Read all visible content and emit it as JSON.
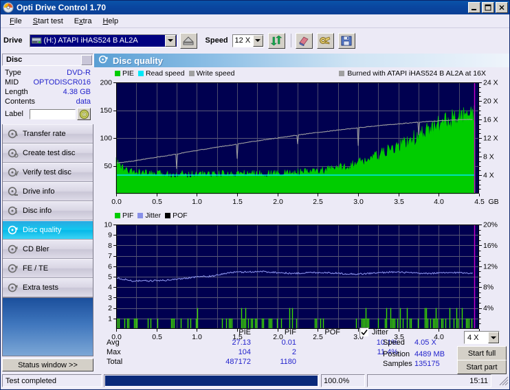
{
  "window": {
    "title": "Opti Drive Control 1.70",
    "icon": "disc-icon",
    "minimize": "minimize-icon",
    "maximize": "maximize-icon",
    "close": "close-icon"
  },
  "menubar": {
    "items": [
      {
        "label": "File",
        "accel": "F"
      },
      {
        "label": "Start test",
        "accel": "S"
      },
      {
        "label": "Extra",
        "accel": "x"
      },
      {
        "label": "Help",
        "accel": "H"
      }
    ]
  },
  "toolbar": {
    "drive_label": "Drive",
    "drive_value": "(H:)   ATAPI iHAS524   B AL2A",
    "eject_icon": "eject-icon",
    "speed_label": "Speed",
    "speed_value": "12 X",
    "refresh_icon": "refresh-icon",
    "erase_icon": "eraser-icon",
    "bitsetting_icon": "bitsetting-icon",
    "save_icon": "save-icon"
  },
  "disc_panel": {
    "header": "Disc",
    "rows": [
      {
        "key": "Type",
        "value": "DVD-R"
      },
      {
        "key": "MID",
        "value": "OPTODISCR016"
      },
      {
        "key": "Length",
        "value": "4.38 GB"
      },
      {
        "key": "Contents",
        "value": "data"
      }
    ],
    "label_key": "Label",
    "label_value": "",
    "label_button_icon": "disc-refresh-icon"
  },
  "nav": {
    "items": [
      {
        "label": "Transfer rate",
        "icon": "disc-rate-icon",
        "selected": false
      },
      {
        "label": "Create test disc",
        "icon": "disc-create-icon",
        "selected": false
      },
      {
        "label": "Verify test disc",
        "icon": "disc-verify-icon",
        "selected": false
      },
      {
        "label": "Drive info",
        "icon": "disc-drive-icon",
        "selected": false
      },
      {
        "label": "Disc info",
        "icon": "disc-info-icon",
        "selected": false
      },
      {
        "label": "Disc quality",
        "icon": "disc-quality-icon",
        "selected": true
      },
      {
        "label": "CD Bler",
        "icon": "disc-bler-icon",
        "selected": false
      },
      {
        "label": "FE / TE",
        "icon": "disc-fete-icon",
        "selected": false
      },
      {
        "label": "Extra tests",
        "icon": "disc-extra-icon",
        "selected": false
      }
    ],
    "status_window_button": "Status window >>"
  },
  "panel": {
    "title": "Disc quality",
    "title_icon": "disc-quality-icon"
  },
  "chart_data": [
    {
      "type": "area",
      "name": "pie-chart",
      "title": "",
      "xlabel": "GB",
      "ylabel": "",
      "xlim": [
        0.0,
        4.5
      ],
      "ylim": [
        0,
        200
      ],
      "y2lim": [
        0,
        24
      ],
      "xticks": [
        "0.0",
        "0.5",
        "1.0",
        "1.5",
        "2.0",
        "2.5",
        "3.0",
        "3.5",
        "4.0",
        "4.5"
      ],
      "x_unit": "GB",
      "yticks": [
        "200",
        "150",
        "100",
        "50"
      ],
      "y2ticks": [
        "24 X",
        "20 X",
        "16 X",
        "12 X",
        "8 X",
        "4 X"
      ],
      "grid": true,
      "legend_position": "top-left",
      "legend": [
        {
          "name": "PIE",
          "color": "#00cc00"
        },
        {
          "name": "Read speed",
          "color": "#00e8f8"
        },
        {
          "name": "Write speed",
          "color": "#a0a0a0"
        }
      ],
      "annotation": {
        "text": "Burned with ATAPI iHAS524   B AL2A at 16X",
        "swatch": "#a0a0a0"
      },
      "series": [
        {
          "name": "PIE",
          "color": "#00cc00",
          "kind": "bars",
          "note": "dense green bars, baseline fill to 0; average about 27, rising from ~30 early to ~120 at end of disc",
          "x": [
            0.0,
            0.1,
            0.2,
            0.3,
            0.4,
            0.5,
            0.6,
            0.7,
            0.8,
            0.9,
            1.0,
            1.1,
            1.2,
            1.3,
            1.4,
            1.5,
            1.6,
            1.7,
            1.8,
            1.9,
            2.0,
            2.1,
            2.2,
            2.3,
            2.4,
            2.5,
            2.6,
            2.7,
            2.8,
            2.9,
            3.0,
            3.1,
            3.2,
            3.3,
            3.4,
            3.5,
            3.6,
            3.7,
            3.8,
            3.9,
            4.0,
            4.1,
            4.2,
            4.3,
            4.4
          ],
          "values": [
            55,
            40,
            36,
            35,
            34,
            33,
            33,
            33,
            33,
            33,
            33,
            33,
            33,
            33,
            33,
            34,
            34,
            34,
            34,
            34,
            35,
            35,
            36,
            36,
            37,
            38,
            40,
            42,
            45,
            48,
            52,
            57,
            62,
            68,
            74,
            80,
            88,
            95,
            102,
            110,
            118,
            124,
            128,
            130,
            132
          ]
        },
        {
          "name": "Read speed",
          "color": "#00e8f8",
          "kind": "line",
          "note": "flat horizontal cyan line at 4X for the whole scan",
          "x": [
            0.0,
            4.45
          ],
          "values": [
            4,
            4
          ]
        },
        {
          "name": "Write speed",
          "color": "#a0a0a0",
          "kind": "line",
          "note": "gray CAV ramp from about 6.5X to 16X with regular downward spikes (link/OPC dips)",
          "x": [
            0.0,
            0.2,
            0.4,
            0.6,
            0.8,
            1.0,
            1.2,
            1.4,
            1.6,
            1.8,
            2.0,
            2.2,
            2.4,
            2.6,
            2.8,
            3.0,
            3.2,
            3.4,
            3.6,
            3.8,
            4.0,
            4.2,
            4.4
          ],
          "values": [
            6.6,
            7.0,
            7.6,
            8.1,
            8.7,
            9.3,
            9.9,
            10.4,
            11.0,
            11.5,
            12.0,
            12.5,
            13.0,
            13.4,
            13.8,
            14.2,
            14.6,
            14.9,
            15.2,
            15.5,
            15.7,
            15.9,
            16.0
          ]
        }
      ]
    },
    {
      "type": "area",
      "name": "pif-jitter-chart",
      "title": "",
      "xlabel": "GB",
      "ylabel": "",
      "xlim": [
        0.0,
        4.5
      ],
      "ylim": [
        0,
        10
      ],
      "y2lim": [
        0,
        20
      ],
      "xticks": [
        "0.0",
        "0.5",
        "1.0",
        "1.5",
        "2.0",
        "2.5",
        "3.0",
        "3.5",
        "4.0",
        "4.5"
      ],
      "x_unit": "GB",
      "yticks": [
        "10",
        "9",
        "8",
        "7",
        "6",
        "5",
        "4",
        "3",
        "2",
        "1"
      ],
      "y2ticks": [
        "20%",
        "16%",
        "12%",
        "8%",
        "4%"
      ],
      "grid": true,
      "legend_position": "top-left",
      "legend": [
        {
          "name": "PIF",
          "color": "#00cc00"
        },
        {
          "name": "Jitter",
          "color": "#8890e8"
        },
        {
          "name": "POF",
          "color": "#000000"
        }
      ],
      "series": [
        {
          "name": "PIF",
          "color": "#00cc00",
          "kind": "bars",
          "note": "sparse green spikes of height 1 or 2 scattered across whole disc, denser near 0.8-1.2 and after 3.4",
          "x": [
            0.0,
            0.2,
            0.4,
            0.6,
            0.8,
            1.0,
            1.2,
            1.4,
            1.6,
            1.8,
            2.0,
            2.2,
            2.4,
            2.6,
            2.8,
            3.0,
            3.2,
            3.4,
            3.6,
            3.8,
            4.0,
            4.2,
            4.4
          ],
          "values": [
            2,
            2,
            1,
            1,
            1,
            1,
            1,
            1,
            2,
            1,
            1,
            1,
            1,
            1,
            1,
            1,
            1,
            2,
            2,
            1,
            2,
            2,
            1
          ]
        },
        {
          "name": "Jitter",
          "color": "#8890e8",
          "kind": "line",
          "note": "light-blue noisy trace on right percentage axis, rising from about 9.4% to 11% then settling near 10.5%",
          "x": [
            0.0,
            0.2,
            0.4,
            0.6,
            0.8,
            1.0,
            1.2,
            1.4,
            1.6,
            1.8,
            2.0,
            2.2,
            2.4,
            2.6,
            2.8,
            3.0,
            3.2,
            3.4,
            3.6,
            3.8,
            4.0,
            4.2,
            4.4
          ],
          "values": [
            9.8,
            9.2,
            9.2,
            9.3,
            9.6,
            10.0,
            10.1,
            10.8,
            10.9,
            11.0,
            10.8,
            10.6,
            10.8,
            10.8,
            10.6,
            10.5,
            10.7,
            10.9,
            10.8,
            10.6,
            10.7,
            10.8,
            10.7
          ]
        },
        {
          "name": "POF",
          "color": "#000000",
          "kind": "bars",
          "note": "no POF errors recorded",
          "x": [],
          "values": []
        }
      ]
    }
  ],
  "stats": {
    "columns": [
      "PIE",
      "PIF",
      "POF"
    ],
    "jitter_label": "Jitter",
    "jitter_checked": true,
    "rows": [
      {
        "label": "Avg",
        "pie": "27.13",
        "pif": "0.01",
        "pof": "",
        "jitter": "10.1%"
      },
      {
        "label": "Max",
        "pie": "104",
        "pif": "2",
        "pof": "",
        "jitter": "11.4%"
      },
      {
        "label": "Total",
        "pie": "487172",
        "pif": "1180",
        "pof": "",
        "jitter": ""
      }
    ],
    "speed_label": "Speed",
    "speed_value": "4.05 X",
    "position_label": "Position",
    "position_value": "4489 MB",
    "samples_label": "Samples",
    "samples_value": "135175",
    "speed_select": "4 X",
    "start_full": "Start full",
    "start_part": "Start part"
  },
  "statusbar": {
    "message": "Test completed",
    "progress_percent": "100.0%",
    "progress_value": 100,
    "time": "15:11"
  },
  "colors": {
    "plot_bg": "#000050",
    "grid": "#5a5a78",
    "pie": "#00cc00",
    "read_speed": "#00e8f8",
    "write_speed": "#a0a0a0",
    "jitter": "#8890e8",
    "marker": "#cc00cc",
    "accent_blue": "#2222cc",
    "titlebar": "#0a46a0"
  }
}
